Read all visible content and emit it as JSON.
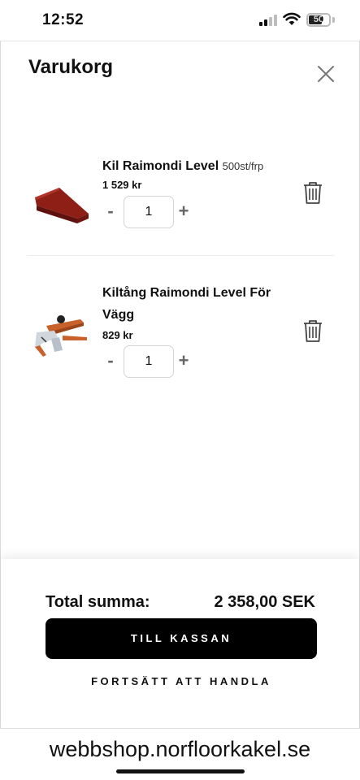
{
  "status": {
    "time": "12:52",
    "battery": "50"
  },
  "cart": {
    "title": "Varukorg",
    "items": [
      {
        "name": "Kil Raimondi Level",
        "unit": "500st/frp",
        "price": "1 529 kr",
        "quantity": "1"
      },
      {
        "name": "Kiltång Raimondi Level För Vägg",
        "unit": "",
        "price": "829 kr",
        "quantity": "1"
      }
    ],
    "minus_label": "-",
    "plus_label": "+"
  },
  "footer": {
    "total_label": "Total summa:",
    "total_value": "2 358,00 SEK",
    "checkout_label": "TILL KASSAN",
    "continue_label": "FORTSÄTT ATT HANDLA"
  },
  "browser": {
    "url": "webbshop.norfloorkakel.se"
  }
}
